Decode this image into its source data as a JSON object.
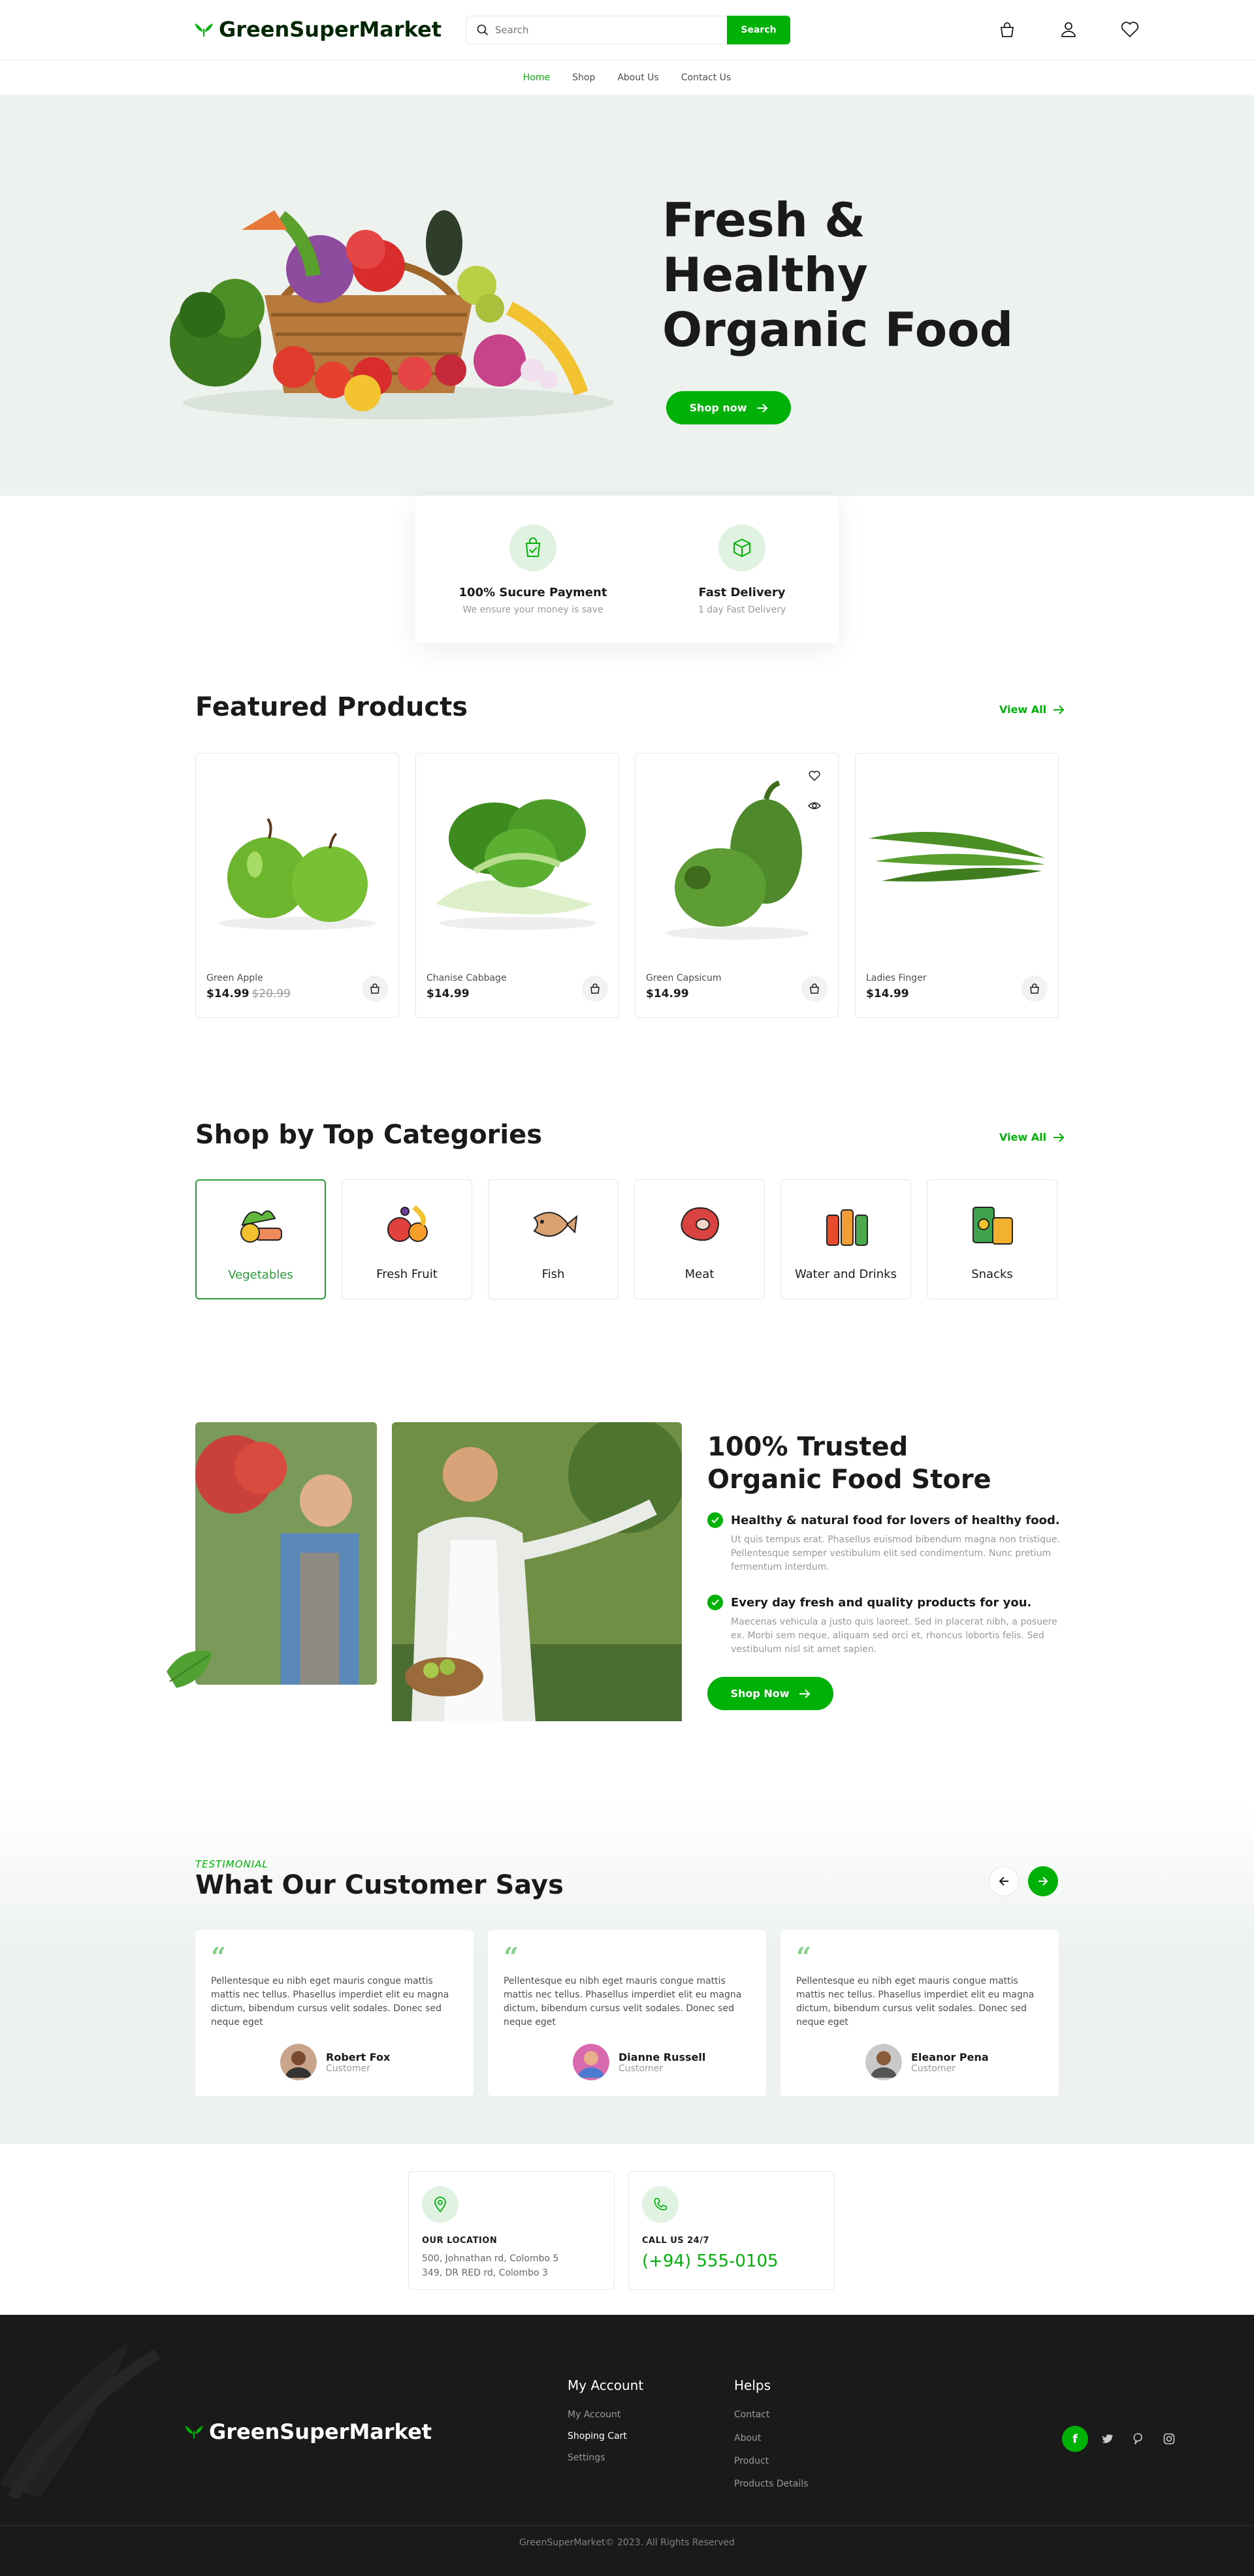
{
  "brand": {
    "name": "GreenSuperMarket",
    "accent": "#00b207"
  },
  "search": {
    "placeholder": "Search",
    "button": "Search"
  },
  "header_icons": [
    "bag-icon",
    "user-icon",
    "heart-icon"
  ],
  "nav": [
    "Home",
    "Shop",
    "About Us",
    "Contact Us"
  ],
  "hero": {
    "title_line1": "Fresh & Healthy",
    "title_line2": "Organic Food",
    "cta": "Shop now"
  },
  "features": [
    {
      "title": "100% Sucure Payment",
      "subtitle": "We ensure your money is save",
      "icon": "shopping-bag-check-icon"
    },
    {
      "title": "Fast Delivery",
      "subtitle": "1 day Fast Delivery",
      "icon": "package-box-icon"
    }
  ],
  "featured": {
    "title": "Featured Products",
    "view_all": "View All",
    "products": [
      {
        "name": "Green Apple",
        "price": "$14.99",
        "old_price": "$20.99"
      },
      {
        "name": "Chanise Cabbage",
        "price": "$14.99",
        "old_price": ""
      },
      {
        "name": "Green Capsicum",
        "price": "$14.99",
        "old_price": ""
      },
      {
        "name": "Ladies Finger",
        "price": "$14.99",
        "old_price": ""
      }
    ]
  },
  "categories": {
    "title": "Shop by Top Categories",
    "view_all": "View All",
    "items": [
      "Vegetables",
      "Fresh Fruit",
      "Fish",
      "Meat",
      "Water and Drinks",
      "Snacks"
    ]
  },
  "trusted": {
    "title_line1": "100% Trusted",
    "title_line2": "Organic Food Store",
    "points": [
      {
        "heading": "Healthy & natural food for lovers of healthy food.",
        "body": "Ut quis tempus erat. Phasellus euismod bibendum magna non tristique. Pellentesque semper vestibulum elit sed condimentum. Nunc pretium fermentum interdum."
      },
      {
        "heading": "Every day fresh and quality products for you.",
        "body": "Maecenas vehicula a justo quis laoreet. Sed in placerat nibh, a posuere ex. Morbi sem neque, aliquam sed orci et, rhoncus lobortis felis. Sed vestibulum nisl sit amet sapien."
      }
    ],
    "cta": "Shop Now"
  },
  "testimonial": {
    "eyebrow": "TESTIMONIAL",
    "title": "What Our Customer Says",
    "items": [
      {
        "text": "Pellentesque eu nibh eget mauris congue mattis mattis nec tellus. Phasellus imperdiet elit eu magna dictum, bibendum cursus velit sodales. Donec sed neque eget",
        "name": "Robert Fox",
        "role": "Customer"
      },
      {
        "text": "Pellentesque eu nibh eget mauris congue mattis mattis nec tellus. Phasellus imperdiet elit eu magna dictum, bibendum cursus velit sodales. Donec sed neque eget",
        "name": "Dianne Russell",
        "role": "Customer"
      },
      {
        "text": "Pellentesque eu nibh eget mauris congue mattis mattis nec tellus. Phasellus imperdiet elit eu magna dictum, bibendum cursus velit sodales. Donec sed neque eget",
        "name": "Eleanor Pena",
        "role": "Customer"
      }
    ]
  },
  "contact": {
    "location_label": "OUR LOCATION",
    "location_line1": "500, Johnathan rd, Colombo 5",
    "location_line2": "349, DR RED rd, Colombo 3",
    "call_label": "CALL US 24/7",
    "phone": "(+94) 555-0105"
  },
  "footer": {
    "my_account": {
      "title": "My Account",
      "links": [
        "My Account",
        "Shoping Cart",
        "Settings"
      ]
    },
    "helps": {
      "title": "Helps",
      "links": [
        "Contact",
        "About",
        "Product",
        "Products Details"
      ]
    },
    "social": [
      "facebook-icon",
      "twitter-icon",
      "pinterest-icon",
      "instagram-icon"
    ],
    "copyright": "GreenSuperMarket© 2023. All Rights Reserved"
  }
}
